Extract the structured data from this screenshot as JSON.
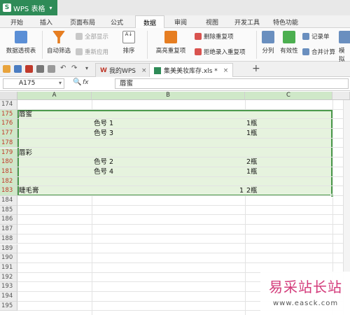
{
  "app": {
    "title": "WPS 表格",
    "logo_letter": "S",
    "brand_color": "#2e8b57"
  },
  "menu": {
    "tabs": [
      "开始",
      "插入",
      "页面布局",
      "公式",
      "数据",
      "审阅",
      "视图",
      "开发工具",
      "特色功能"
    ],
    "active": "数据"
  },
  "ribbon": {
    "pivot": "数据透视表",
    "autofilter": "自动筛选",
    "show_all": "全部显示",
    "reapply": "重新应用",
    "sort": "排序",
    "highlight_dup": "高亮重复项",
    "delete_dup": "删除重复项",
    "reject_dup": "拒绝录入重复项",
    "split": "分列",
    "validity": "有效性",
    "record": "记录单",
    "consolidate": "合并计算",
    "simulate": "模拟"
  },
  "doctabs": {
    "home": "我的WPS",
    "file": "集美美妆库存.xls *",
    "close_symbol": "×",
    "add_symbol": "+"
  },
  "formula": {
    "cell_ref": "A175",
    "fx": "fx",
    "content": "唇蜜"
  },
  "columns": [
    "A",
    "B",
    "C"
  ],
  "rows": [
    "174",
    "175",
    "176",
    "177",
    "178",
    "179",
    "180",
    "181",
    "182",
    "183",
    "184",
    "185",
    "186",
    "187",
    "188",
    "189",
    "190",
    "191",
    "192",
    "193",
    "194",
    "195"
  ],
  "cells": {
    "r175_a": "唇蜜",
    "r176_b": "色号  1",
    "r176_c": "1瓶",
    "r177_b": "色号  3",
    "r177_c": "1瓶",
    "r179_a": "唇彩",
    "r180_b": "色号  2",
    "r180_c": "2瓶",
    "r181_b": "色号  4",
    "r181_c": "1瓶",
    "r183_a": "睫毛膏",
    "r183_b": "1",
    "r183_c": "2瓶"
  },
  "watermark": {
    "title": "易采站长站",
    "url": "www.easck.com"
  }
}
